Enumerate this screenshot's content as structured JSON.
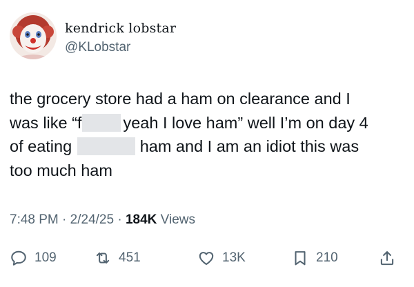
{
  "author": {
    "display_name": "kendrick lobstar",
    "handle": "@KLobstar"
  },
  "post": {
    "lines": [
      {
        "text": "the grocery store had a ham on clearance  and I"
      },
      {
        "before": "was like “f",
        "after": "yeah I love ham” well I’m on day 4"
      },
      {
        "before": "of eating",
        "after": "ham and I am an idiot this was"
      },
      {
        "text": "too much ham"
      }
    ]
  },
  "meta": {
    "time": "7:48 PM",
    "date": "2/24/25",
    "separator": "·",
    "views_count": "184K",
    "views_label": "Views"
  },
  "actions": {
    "replies": "109",
    "reposts": "451",
    "likes": "13K",
    "bookmarks": "210"
  },
  "icons": {
    "reply": "reply-icon",
    "repost": "repost-icon",
    "like": "heart-icon",
    "bookmark": "bookmark-icon",
    "share": "share-icon"
  },
  "colors": {
    "text": "#0f1419",
    "muted": "#536471",
    "redaction": "#e3e5e8"
  }
}
